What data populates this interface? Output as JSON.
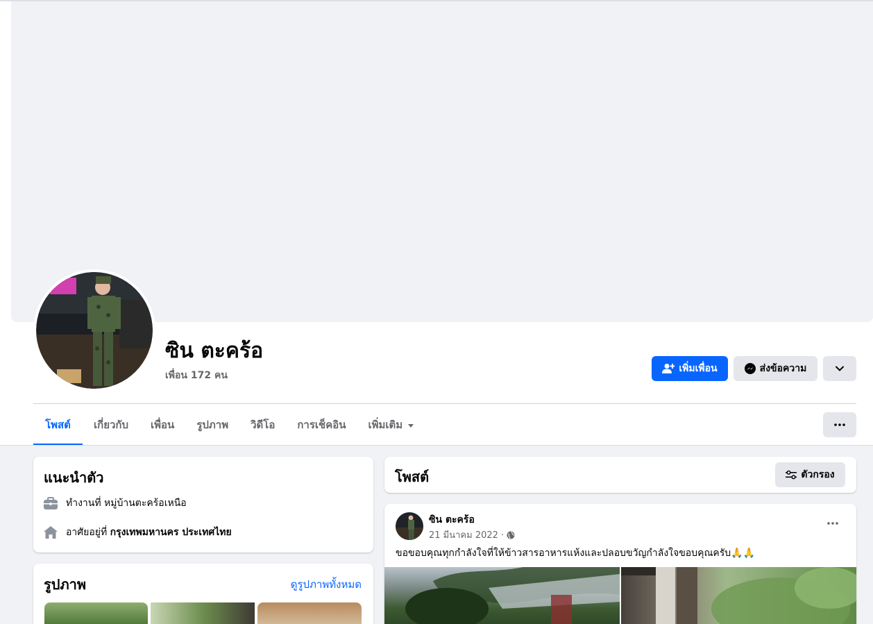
{
  "profile": {
    "name": "ซิน ตะคร้อ",
    "friends_count": "เพื่อน 172 คน"
  },
  "actions": {
    "add_friend": "เพิ่มเพื่อน",
    "message": "ส่งข้อความ"
  },
  "tabs": [
    {
      "label": "โพสต์",
      "active": true
    },
    {
      "label": "เกี่ยวกับ"
    },
    {
      "label": "เพื่อน"
    },
    {
      "label": "รูปภาพ"
    },
    {
      "label": "วิดีโอ"
    },
    {
      "label": "การเช็คอิน"
    },
    {
      "label": "เพิ่มเติม"
    }
  ],
  "intro": {
    "title": "แนะนำตัว",
    "work": "ทำงานที่ หมู่บ้านตะคร้อเหนือ",
    "lives_prefix": "อาศัยอยู่ที่ ",
    "lives_place": "กรุงเทพมหานคร ประเทศไทย"
  },
  "photos": {
    "title": "รูปภาพ",
    "see_all": "ดูรูปภาพทั้งหมด"
  },
  "posts_header": {
    "title": "โพสต์",
    "filter": "ตัวกรอง"
  },
  "post": {
    "author": "ซิน ตะคร้อ",
    "date": "21 มีนาคม 2022 ·",
    "text": "ขอขอบคุณทุกกำลังใจที่ให้ข้าวสารอาหารแห้งและปลอบขวัญกำลังใจขอบคุณครับ🙏🙏"
  },
  "colors": {
    "accent": "#0866ff",
    "page_bg": "#f0f2f5",
    "secondary_text": "#65676b",
    "button_gray": "#e4e6eb"
  },
  "icons": [
    "add-friend-icon",
    "messenger-icon",
    "chevron-down-icon",
    "more-icon",
    "briefcase-icon",
    "home-icon",
    "filter-icon",
    "globe-icon"
  ]
}
